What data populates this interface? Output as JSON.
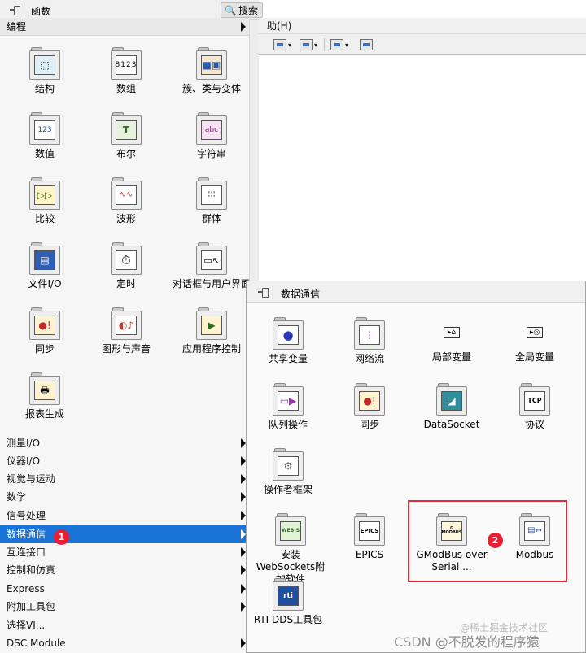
{
  "editor": {
    "menu_label": "助(H)"
  },
  "palette": {
    "title": "函数",
    "search_label": "搜索",
    "top_category": "编程",
    "items": [
      {
        "label": "结构",
        "icon": "structures-icon"
      },
      {
        "label": "数组",
        "icon": "array-icon",
        "glyph": "8123"
      },
      {
        "label": "簇、类与变体",
        "icon": "cluster-icon"
      },
      {
        "label": "数值",
        "icon": "numeric-icon",
        "glyph": "123"
      },
      {
        "label": "布尔",
        "icon": "boolean-icon",
        "glyph": "T"
      },
      {
        "label": "字符串",
        "icon": "string-icon",
        "glyph": "abc"
      },
      {
        "label": "比较",
        "icon": "comparison-icon"
      },
      {
        "label": "波形",
        "icon": "waveform-icon"
      },
      {
        "label": "群体",
        "icon": "group-icon"
      },
      {
        "label": "文件I/O",
        "icon": "file-io-icon"
      },
      {
        "label": "定时",
        "icon": "timing-icon"
      },
      {
        "label": "对话框与用户界面",
        "icon": "dialog-ui-icon"
      },
      {
        "label": "同步",
        "icon": "synchronization-icon"
      },
      {
        "label": "图形与声音",
        "icon": "graphics-sound-icon"
      },
      {
        "label": "应用程序控制",
        "icon": "app-control-icon"
      },
      {
        "label": "报表生成",
        "icon": "report-icon"
      }
    ],
    "categories": [
      "测量I/O",
      "仪器I/O",
      "视觉与运动",
      "数学",
      "信号处理",
      "数据通信",
      "互连接口",
      "控制和仿真",
      "Express",
      "附加工具包",
      "选择VI...",
      "DSC Module"
    ],
    "active_category": "数据通信",
    "badge_1": "1"
  },
  "subpalette": {
    "title": "数据通信",
    "items": [
      {
        "label": "共享变量",
        "icon": "shared-variable-icon"
      },
      {
        "label": "网络流",
        "icon": "network-stream-icon"
      },
      {
        "label": "局部变量",
        "icon": "local-variable-icon"
      },
      {
        "label": "全局变量",
        "icon": "global-variable-icon"
      },
      {
        "label": "队列操作",
        "icon": "queue-icon"
      },
      {
        "label": "同步",
        "icon": "synchronization-icon"
      },
      {
        "label": "DataSocket",
        "icon": "datasocket-icon"
      },
      {
        "label": "协议",
        "icon": "protocols-icon",
        "glyph": "TCP"
      },
      {
        "label": "操作者框架",
        "icon": "actor-framework-icon"
      },
      {
        "label": "安装WebSockets附加软件",
        "icon": "websockets-icon",
        "glyph": "WEB-S"
      },
      {
        "label": "EPICS",
        "icon": "epics-icon",
        "glyph": "EPICS"
      },
      {
        "label": "GModBus over Serial ...",
        "icon": "gmodbus-icon",
        "glyph": "G MODBUS"
      },
      {
        "label": "Modbus",
        "icon": "modbus-icon"
      },
      {
        "label": "RTI DDS工具包",
        "icon": "rti-dds-icon",
        "glyph": "rti"
      }
    ],
    "badge_2": "2"
  },
  "watermark": {
    "line1": "@稀土掘金技术社区",
    "line2": "CSDN @不脱发的程序猿"
  }
}
